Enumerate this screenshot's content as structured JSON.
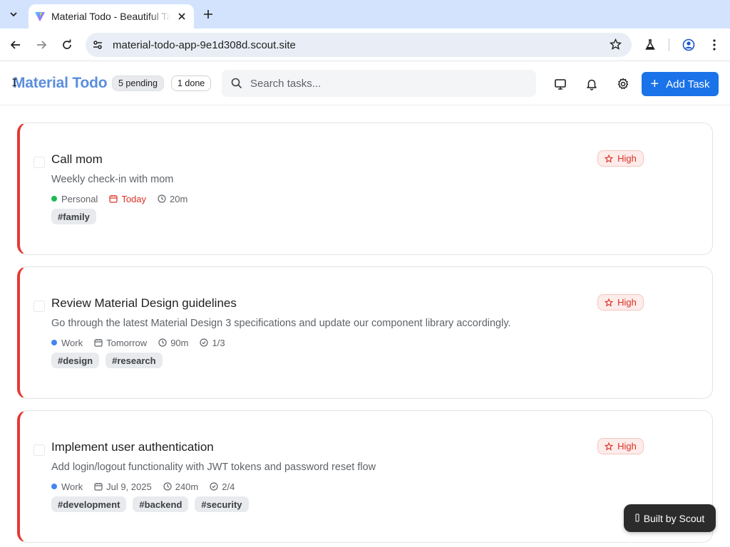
{
  "browser": {
    "tab_title": "Material Todo - Beautiful Task Manager",
    "url": "material-todo-app-9e1d308d.scout.site"
  },
  "header": {
    "app_title": "Material Todo",
    "pending_badge": "5 pending",
    "done_badge": "1 done",
    "search_placeholder": "Search tasks...",
    "add_task_label": "Add Task"
  },
  "colors": {
    "accent": "#1a73e8",
    "high_priority": "#e53935",
    "work_category": "#4285f4",
    "personal_category": "#1db954"
  },
  "tasks": [
    {
      "title": "Call mom",
      "description": "Weekly check-in with mom",
      "category": "Personal",
      "category_color": "#1db954",
      "due": "Today",
      "duration": "20m",
      "subtasks": "",
      "tags": [
        "#family"
      ],
      "priority": "High"
    },
    {
      "title": "Review Material Design guidelines",
      "description": "Go through the latest Material Design 3 specifications and update our component library accordingly.",
      "category": "Work",
      "category_color": "#4285f4",
      "due": "Tomorrow",
      "duration": "90m",
      "subtasks": "1/3",
      "tags": [
        "#design",
        "#research"
      ],
      "priority": "High"
    },
    {
      "title": "Implement user authentication",
      "description": "Add login/logout functionality with JWT tokens and password reset flow",
      "category": "Work",
      "category_color": "#4285f4",
      "due": "Jul 9, 2025",
      "duration": "240m",
      "subtasks": "2/4",
      "tags": [
        "#development",
        "#backend",
        "#security"
      ],
      "priority": "High"
    }
  ],
  "footer": {
    "scout_badge": "Built by Scout"
  }
}
